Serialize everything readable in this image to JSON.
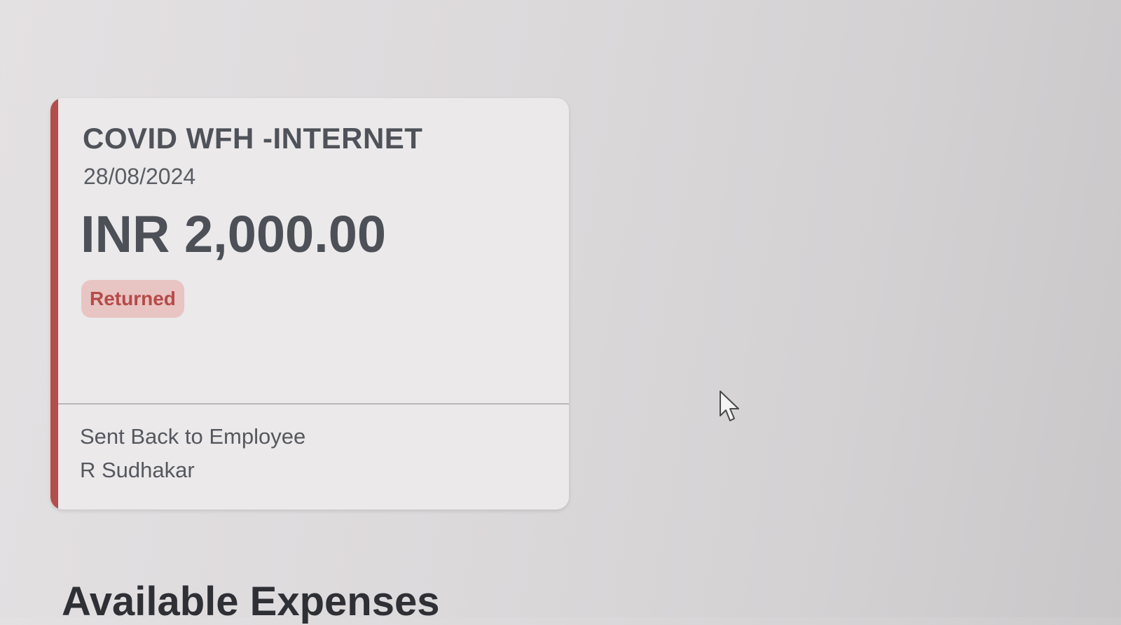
{
  "expense_card": {
    "title": "COVID WFH -INTERNET",
    "date": "28/08/2024",
    "amount": "INR 2,000.00",
    "status": "Returned",
    "footer_status": "Sent Back to Employee",
    "footer_person": "R Sudhakar"
  },
  "section": {
    "heading": "Available Expenses"
  },
  "colors": {
    "accent": "#b34e4a",
    "status_text": "#b54b48",
    "status_background": "#e8c4c3"
  },
  "icons": {
    "cursor": "mouse-pointer-icon"
  }
}
